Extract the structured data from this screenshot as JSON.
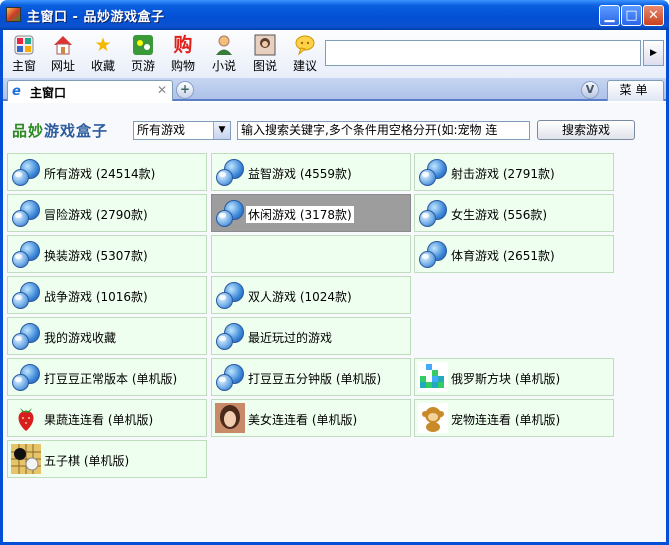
{
  "window": {
    "title": "主窗口 - 品妙游戏盒子"
  },
  "toolbar": {
    "buttons": [
      {
        "label": "主窗",
        "icon": "grid-home-icon"
      },
      {
        "label": "网址",
        "icon": "house-icon"
      },
      {
        "label": "收藏",
        "icon": "star-icon"
      },
      {
        "label": "页游",
        "icon": "game-icon"
      },
      {
        "label": "购物",
        "icon": "shopping-icon"
      },
      {
        "label": "小说",
        "icon": "reader-icon"
      },
      {
        "label": "图说",
        "icon": "photo-icon"
      },
      {
        "label": "建议",
        "icon": "speech-bubble-icon"
      }
    ]
  },
  "tabs": {
    "active_label": "主窗口",
    "menu_label": "菜单"
  },
  "search": {
    "logo_part1": "品妙",
    "logo_part2": "游戏盒子",
    "category_selected": "所有游戏",
    "input_value": "输入搜索关键字,多个条件用空格分开(如:宠物 连",
    "button_label": "搜索游戏"
  },
  "tiles": [
    {
      "label": "所有游戏 (24514款)",
      "icon": "globe-icon"
    },
    {
      "label": "益智游戏 (4559款)",
      "icon": "globe-icon"
    },
    {
      "label": "射击游戏 (2791款)",
      "icon": "globe-icon"
    },
    {
      "label": "冒险游戏 (2790款)",
      "icon": "globe-icon"
    },
    {
      "label": "休闲游戏 (3178款)",
      "icon": "globe-icon",
      "selected": true
    },
    {
      "label": "女生游戏 (556款)",
      "icon": "globe-icon"
    },
    {
      "label": "换装游戏 (5307款)",
      "icon": "globe-icon"
    },
    {
      "label": "",
      "icon": ""
    },
    {
      "label": "体育游戏 (2651款)",
      "icon": "globe-icon"
    },
    {
      "label": "战争游戏 (1016款)",
      "icon": "globe-icon"
    },
    {
      "label": "双人游戏 (1024款)",
      "icon": "globe-icon"
    },
    {
      "label": "我的游戏收藏",
      "icon": "globe-icon"
    },
    {
      "label": "最近玩过的游戏",
      "icon": "globe-icon"
    },
    {
      "label": "打豆豆正常版本 (单机版)",
      "icon": "globe-icon"
    },
    {
      "label": "打豆豆五分钟版 (单机版)",
      "icon": "globe-icon"
    },
    {
      "label": "俄罗斯方块 (单机版)",
      "icon": "tetris-icon"
    },
    {
      "label": "果蔬连连看 (单机版)",
      "icon": "strawberry-icon"
    },
    {
      "label": "美女连连看 (单机版)",
      "icon": "portrait-icon"
    },
    {
      "label": "宠物连连看 (单机版)",
      "icon": "monkey-icon"
    },
    {
      "label": "五子棋 (单机版)",
      "icon": "go-board-icon"
    }
  ]
}
